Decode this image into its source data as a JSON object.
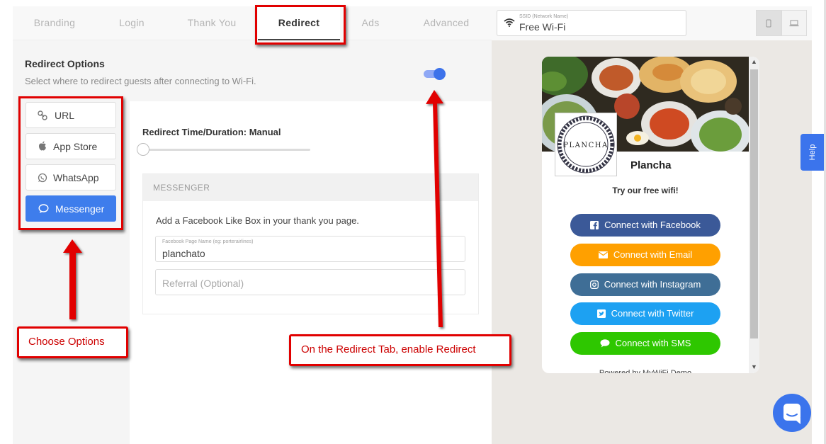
{
  "tabs": [
    {
      "label": "Branding",
      "active": false
    },
    {
      "label": "Login",
      "active": false
    },
    {
      "label": "Thank You",
      "active": false
    },
    {
      "label": "Redirect",
      "active": true
    },
    {
      "label": "Ads",
      "active": false
    },
    {
      "label": "Advanced",
      "active": false
    }
  ],
  "ssid": {
    "label": "SSID (Network Name)",
    "value": "Free Wi-Fi",
    "icon": "wifi-icon"
  },
  "device_toggle": {
    "icons": [
      "mobile-icon",
      "laptop-icon"
    ]
  },
  "redirect_options": {
    "title": "Redirect Options",
    "subtitle": "Select where to redirect guests after connecting to Wi-Fi.",
    "enabled": true,
    "options": [
      {
        "label": "URL",
        "icon": "link-icon",
        "active": false
      },
      {
        "label": "App Store",
        "icon": "apple-icon",
        "active": false
      },
      {
        "label": "WhatsApp",
        "icon": "whatsapp-icon",
        "active": false
      },
      {
        "label": "Messenger",
        "icon": "messenger-icon",
        "active": true
      }
    ]
  },
  "redirect_time": {
    "label": "Redirect Time/Duration: Manual",
    "value": 0
  },
  "messenger": {
    "header": "MESSENGER",
    "description": "Add a Facebook Like Box in your thank you page.",
    "page_name_label": "Facebook Page Name (eg: porterairlines)",
    "page_name_value": "planchato",
    "referral_placeholder": "Referral (Optional)"
  },
  "preview": {
    "logo_text": "PLANCHA",
    "brand": "Plancha",
    "tagline": "Try our free wifi!",
    "buttons": [
      {
        "label": "Connect with Facebook",
        "icon": "facebook-icon",
        "color": "#3b5998"
      },
      {
        "label": "Connect with Email",
        "icon": "email-icon",
        "color": "#ffa000"
      },
      {
        "label": "Connect with Instagram",
        "icon": "instagram-icon",
        "color": "#3f6e96"
      },
      {
        "label": "Connect with Twitter",
        "icon": "twitter-icon",
        "color": "#1da1f2"
      },
      {
        "label": "Connect with SMS",
        "icon": "sms-icon",
        "color": "#2ec700"
      }
    ],
    "powered_by": "Powered by MyWiFi Demo"
  },
  "help": {
    "label": "Help"
  },
  "annotations": {
    "choose_options": "Choose Options",
    "enable_redirect": "On the Redirect Tab, enable Redirect",
    "color": "#e10000"
  }
}
